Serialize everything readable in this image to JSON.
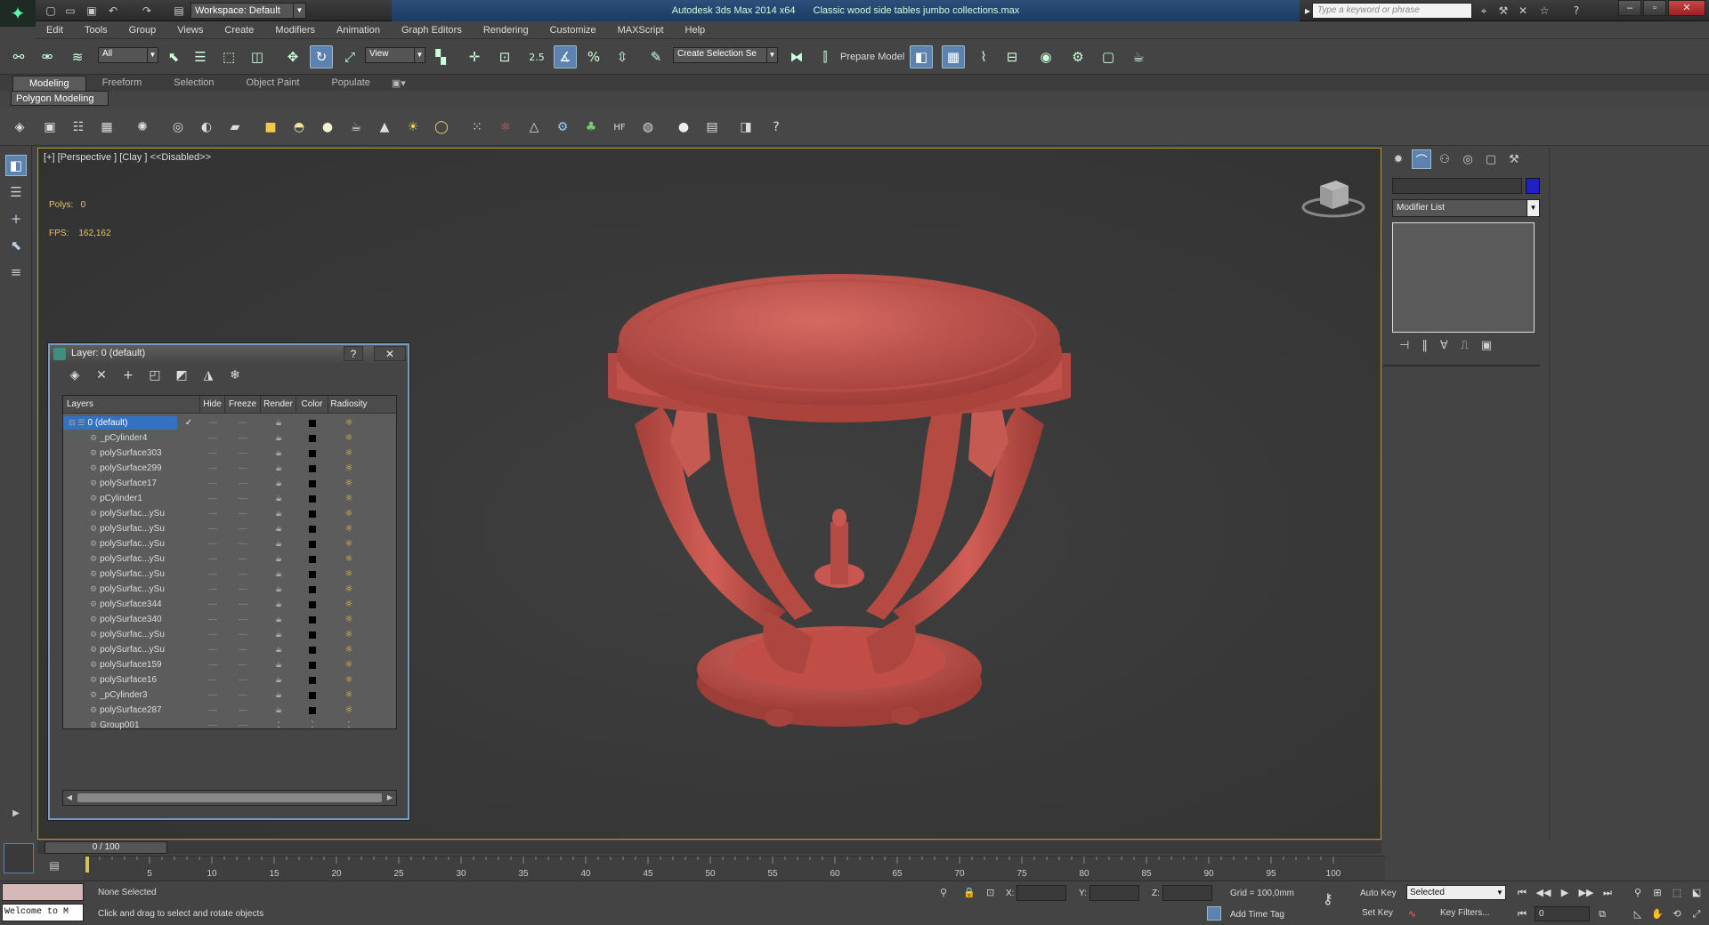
{
  "titlebar": {
    "workspace": "Workspace: Default",
    "app": "Autodesk 3ds Max  2014 x64",
    "file": "Classic wood side tables  jumbo collections.max",
    "search_placeholder": "Type a keyword or phrase"
  },
  "menu": [
    "Edit",
    "Tools",
    "Group",
    "Views",
    "Create",
    "Modifiers",
    "Animation",
    "Graph Editors",
    "Rendering",
    "Customize",
    "MAXScript",
    "Help"
  ],
  "toolbar": {
    "filter": "All",
    "refcoord": "View",
    "selection_set": "Create Selection Se",
    "prepare_model": "Prepare Model",
    "snap_value": "2.5"
  },
  "ribbon": {
    "tabs": [
      "Modeling",
      "Freeform",
      "Selection",
      "Object Paint",
      "Populate"
    ],
    "panel": "Polygon Modeling"
  },
  "viewport": {
    "label": "[+] [Perspective ] [Clay ]  <<Disabled>>",
    "polys_label": "Polys:",
    "polys_value": "0",
    "fps_label": "FPS:",
    "fps_value": "162,162",
    "model_color": "#c8564f"
  },
  "layer_dialog": {
    "title": "Layer: 0 (default)",
    "help": "?",
    "close": "✕",
    "columns": [
      "Layers",
      "Hide",
      "Freeze",
      "Render",
      "Color",
      "Radiosity"
    ],
    "rows": [
      {
        "name": "0 (default)",
        "check": "✓",
        "selected": true
      },
      {
        "name": "_pCylinder4"
      },
      {
        "name": "polySurface303"
      },
      {
        "name": "polySurface299"
      },
      {
        "name": "polySurface17"
      },
      {
        "name": "pCylinder1"
      },
      {
        "name": "polySurfac...ySu"
      },
      {
        "name": "polySurfac...ySu"
      },
      {
        "name": "polySurfac...ySu"
      },
      {
        "name": "polySurfac...ySu"
      },
      {
        "name": "polySurfac...ySu"
      },
      {
        "name": "polySurfac...ySu"
      },
      {
        "name": "polySurface344"
      },
      {
        "name": "polySurface340"
      },
      {
        "name": "polySurfac...ySu"
      },
      {
        "name": "polySurfac...ySu"
      },
      {
        "name": "polySurface159"
      },
      {
        "name": "polySurface16"
      },
      {
        "name": "_pCylinder3"
      },
      {
        "name": "polySurface287"
      },
      {
        "name": "Group001",
        "group": true
      }
    ]
  },
  "command_panel": {
    "modifier_list": "Modifier List",
    "swatch_color": "#2020c8"
  },
  "timeline": {
    "slider": "0 / 100",
    "ticks": [
      "5",
      "10",
      "15",
      "20",
      "25",
      "30",
      "35",
      "40",
      "45",
      "50",
      "55",
      "60",
      "65",
      "70",
      "75",
      "80",
      "85",
      "90",
      "95",
      "100"
    ]
  },
  "status": {
    "maxscript": "Welcome to M",
    "selection": "None Selected",
    "prompt": "Click and drag to select and rotate objects",
    "x": "X:",
    "y": "Y:",
    "z": "Z:",
    "grid": "Grid = 100,0mm",
    "add_time_tag": "Add Time Tag",
    "auto_key": "Auto Key",
    "set_key": "Set Key",
    "selected": "Selected",
    "key_filters": "Key Filters...",
    "frame": "0"
  }
}
